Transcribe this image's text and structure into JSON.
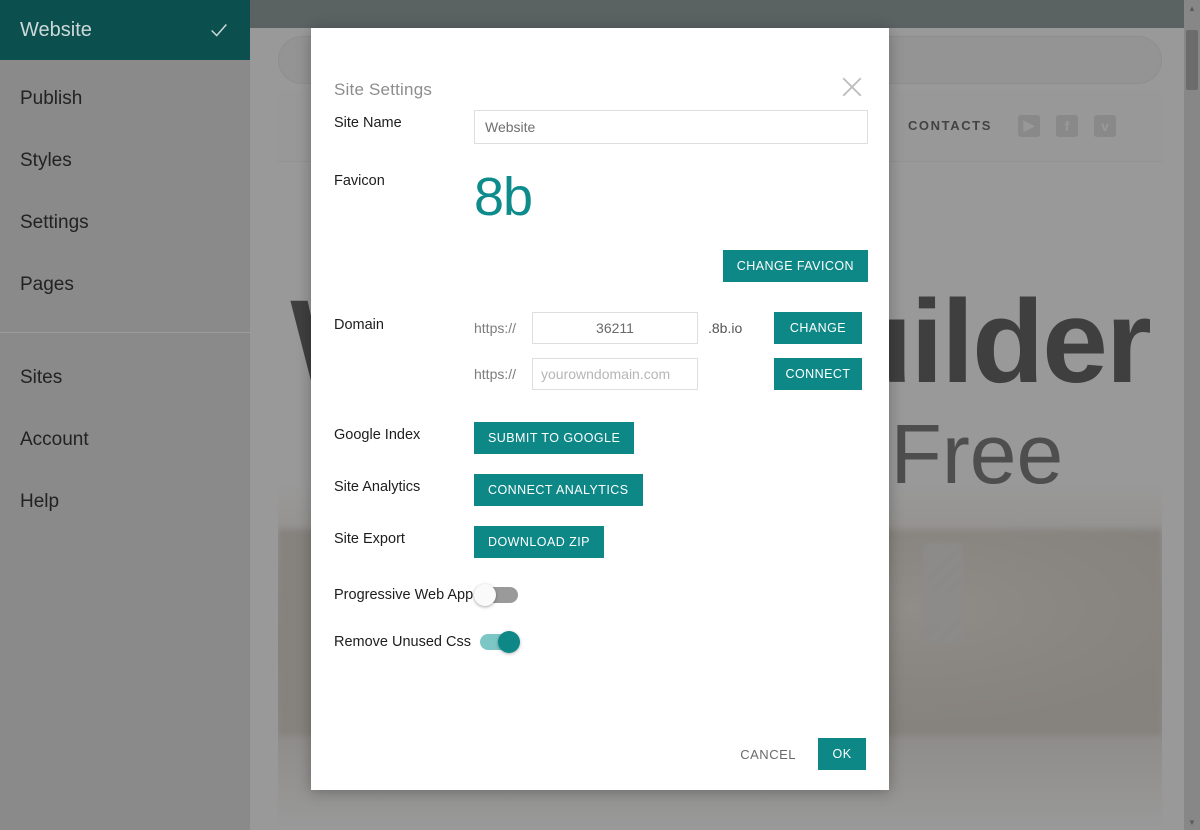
{
  "sidebar": {
    "active": {
      "label": "Website",
      "icon": "check-icon"
    },
    "items": [
      {
        "label": "Publish"
      },
      {
        "label": "Styles"
      },
      {
        "label": "Settings"
      },
      {
        "label": "Pages"
      }
    ],
    "items2": [
      {
        "label": "Sites"
      },
      {
        "label": "Account"
      },
      {
        "label": "Help"
      }
    ]
  },
  "preview": {
    "nav_link": "CONTACTS",
    "social": [
      {
        "name": "youtube-icon",
        "glyph": "▶"
      },
      {
        "name": "facebook-icon",
        "glyph": "f"
      },
      {
        "name": "twitter-icon",
        "glyph": "ᴠ"
      }
    ],
    "hero_title": "Website Builder",
    "hero_sub": "Beautiful and Free",
    "scroll_up": "▲",
    "scroll_down": "▼"
  },
  "modal": {
    "title": "Site Settings",
    "close_icon": "close-icon",
    "site_name": {
      "label": "Site Name",
      "value": "Website",
      "placeholder": "Website"
    },
    "favicon": {
      "label": "Favicon",
      "mark": "8b",
      "change_button": "CHANGE FAVICON"
    },
    "domain": {
      "label": "Domain",
      "scheme": "https://",
      "value": "36211",
      "tld": ".8b.io",
      "change_button": "CHANGE",
      "custom_scheme": "https://",
      "custom_placeholder": "yourowndomain.com",
      "custom_value": "",
      "connect_button": "CONNECT"
    },
    "google_index": {
      "label": "Google Index",
      "button": "SUBMIT TO GOOGLE"
    },
    "site_analytics": {
      "label": "Site Analytics",
      "button": "CONNECT ANALYTICS"
    },
    "site_export": {
      "label": "Site Export",
      "button": "DOWNLOAD ZIP"
    },
    "pwa": {
      "label": "Progressive Web App",
      "state": "off"
    },
    "remove_css": {
      "label": "Remove Unused Css",
      "state": "on"
    },
    "cancel_button": "CANCEL",
    "ok_button": "OK"
  },
  "colors": {
    "accent_teal": "#0e8787",
    "sidebar_active": "#0b4f4f",
    "sidebar_bg": "#8a8a8a",
    "favicon_teal": "#0e8b8b",
    "toggle_on_track": "#7cc6c6",
    "top_band": "#5d6e6e"
  }
}
